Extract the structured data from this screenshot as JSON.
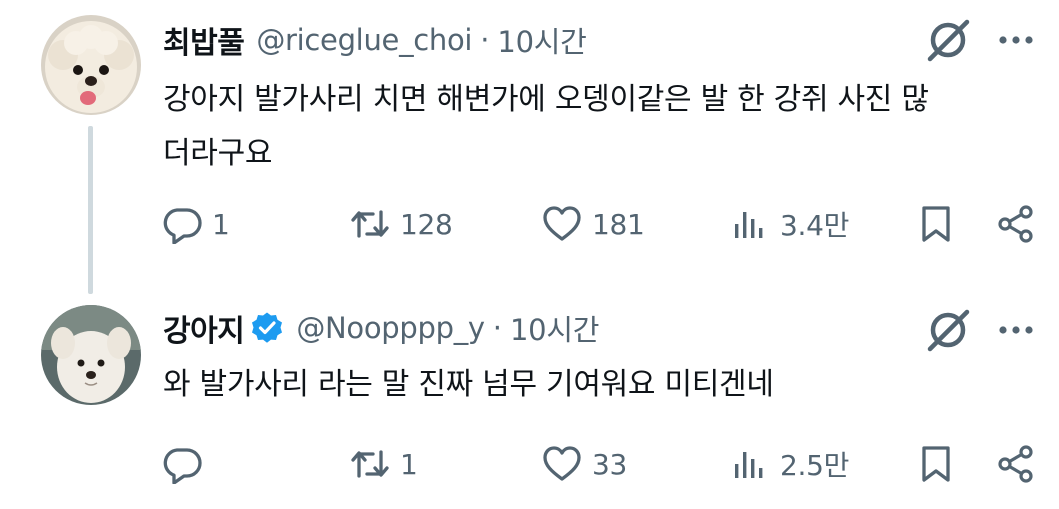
{
  "tweets": [
    {
      "display_name": "최밥풀",
      "verified": false,
      "handle": "@riceglue_choi",
      "separator": "·",
      "time": "10시간",
      "text_line1": "강아지 발가사리 치면 해변가에 오뎅이같은 발 한 강쥐 사진 많",
      "text_line2": "더라구요",
      "replies": "1",
      "retweets": "128",
      "likes": "181",
      "views": "3.4만"
    },
    {
      "display_name": "강아지",
      "verified": true,
      "handle": "@Noopppp_y",
      "separator": "·",
      "time": "10시간",
      "text_line1": "와 발가사리 라는 말 진짜 넘무 기여워요 미티겐네",
      "replies": "",
      "retweets": "1",
      "likes": "33",
      "views": "2.5만"
    }
  ],
  "icons": {
    "reply": "reply-icon",
    "retweet": "retweet-icon",
    "like": "heart-icon",
    "views": "views-chart-icon",
    "bookmark": "bookmark-icon",
    "share": "share-icon",
    "grok": "grok-icon",
    "more": "more-dots-icon",
    "verified": "verified-badge-icon"
  },
  "colors": {
    "text": "#0f1419",
    "secondary": "#536471",
    "verified": "#1d9bf0",
    "thread_line": "#cfd9de"
  }
}
